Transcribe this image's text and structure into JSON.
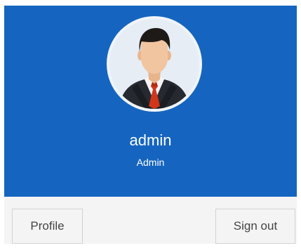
{
  "user": {
    "name": "admin",
    "role": "Admin"
  },
  "footer": {
    "profile_label": "Profile",
    "signout_label": "Sign out"
  },
  "colors": {
    "header_background": "#1565c0",
    "footer_background": "#f4f4f4"
  },
  "icons": {
    "avatar": "businessman-avatar-icon"
  }
}
